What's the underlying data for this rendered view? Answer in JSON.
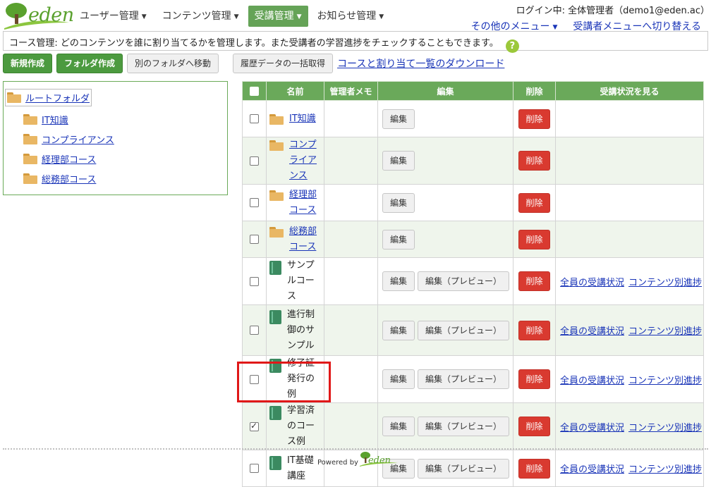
{
  "brand": {
    "logo_text": "eden"
  },
  "nav": [
    {
      "label": "ユーザー管理",
      "active": false
    },
    {
      "label": "コンテンツ管理",
      "active": false
    },
    {
      "label": "受講管理",
      "active": true
    },
    {
      "label": "お知らせ管理",
      "active": false
    }
  ],
  "header": {
    "login_text": "ログイン中: 全体管理者（demo1@eden.ac）",
    "other_menu": "その他のメニュー",
    "switch_menu": "受講者メニューへ切り替える"
  },
  "info": {
    "text": "コース管理: どのコンテンツを誰に割り当てるかを管理します。また受講者の学習進捗をチェックすることもできます。",
    "help_icon": "?"
  },
  "toolbar": {
    "new": "新規作成",
    "new_folder": "フォルダ作成",
    "move": "別のフォルダへ移動",
    "bulk": "履歴データの一括取得",
    "download": "コースと割り当て一覧のダウンロード"
  },
  "tree": {
    "root": "ルートフォルダ",
    "items": [
      "IT知識",
      "コンプライアンス",
      "経理部コース",
      "総務部コース"
    ]
  },
  "table": {
    "headers": {
      "name": "名前",
      "memo": "管理者メモ",
      "edit": "編集",
      "delete": "削除",
      "status": "受講状況を見る"
    },
    "labels": {
      "edit": "編集",
      "preview": "編集（プレビュー）",
      "delete": "削除",
      "all": "全員の受講状況",
      "per": "コンテンツ別進捗"
    },
    "rows": [
      {
        "type": "folder",
        "name": "IT知識",
        "checked": false
      },
      {
        "type": "folder",
        "name": "コンプライアンス",
        "checked": false
      },
      {
        "type": "folder",
        "name": "経理部コース",
        "checked": false
      },
      {
        "type": "folder",
        "name": "総務部コース",
        "checked": false
      },
      {
        "type": "course",
        "name": "サンプルコース",
        "checked": false
      },
      {
        "type": "course",
        "name": "進行制御のサンプル",
        "checked": false
      },
      {
        "type": "course",
        "name": "修了証発行の例",
        "checked": false
      },
      {
        "type": "course",
        "name": "学習済のコース例",
        "checked": true
      },
      {
        "type": "course",
        "name": "IT基礎講座",
        "checked": false
      }
    ]
  },
  "footer": {
    "powered_by": "Powered by",
    "logo_text": "eden"
  },
  "colors": {
    "brand_green": "#65a357",
    "header_green": "#6aa95a",
    "delete_red": "#d93a30",
    "highlight_red": "#e01818"
  }
}
